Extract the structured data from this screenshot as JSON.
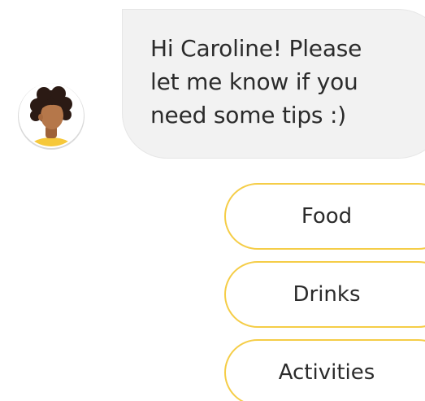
{
  "chat": {
    "assistant_message": "Hi Caroline! Please\nlet me know if you\nneed some tips :)",
    "avatar_icon": "person-avatar-icon"
  },
  "quick_replies": [
    {
      "label": "Food"
    },
    {
      "label": "Drinks"
    },
    {
      "label": "Activities"
    }
  ],
  "colors": {
    "bubble_background": "#f2f2f2",
    "chip_border": "#f5cd47",
    "avatar_shirt": "#f6c83a",
    "avatar_skin": "#b5774a",
    "avatar_hair": "#2b1a14",
    "text": "#2b2b2b"
  }
}
